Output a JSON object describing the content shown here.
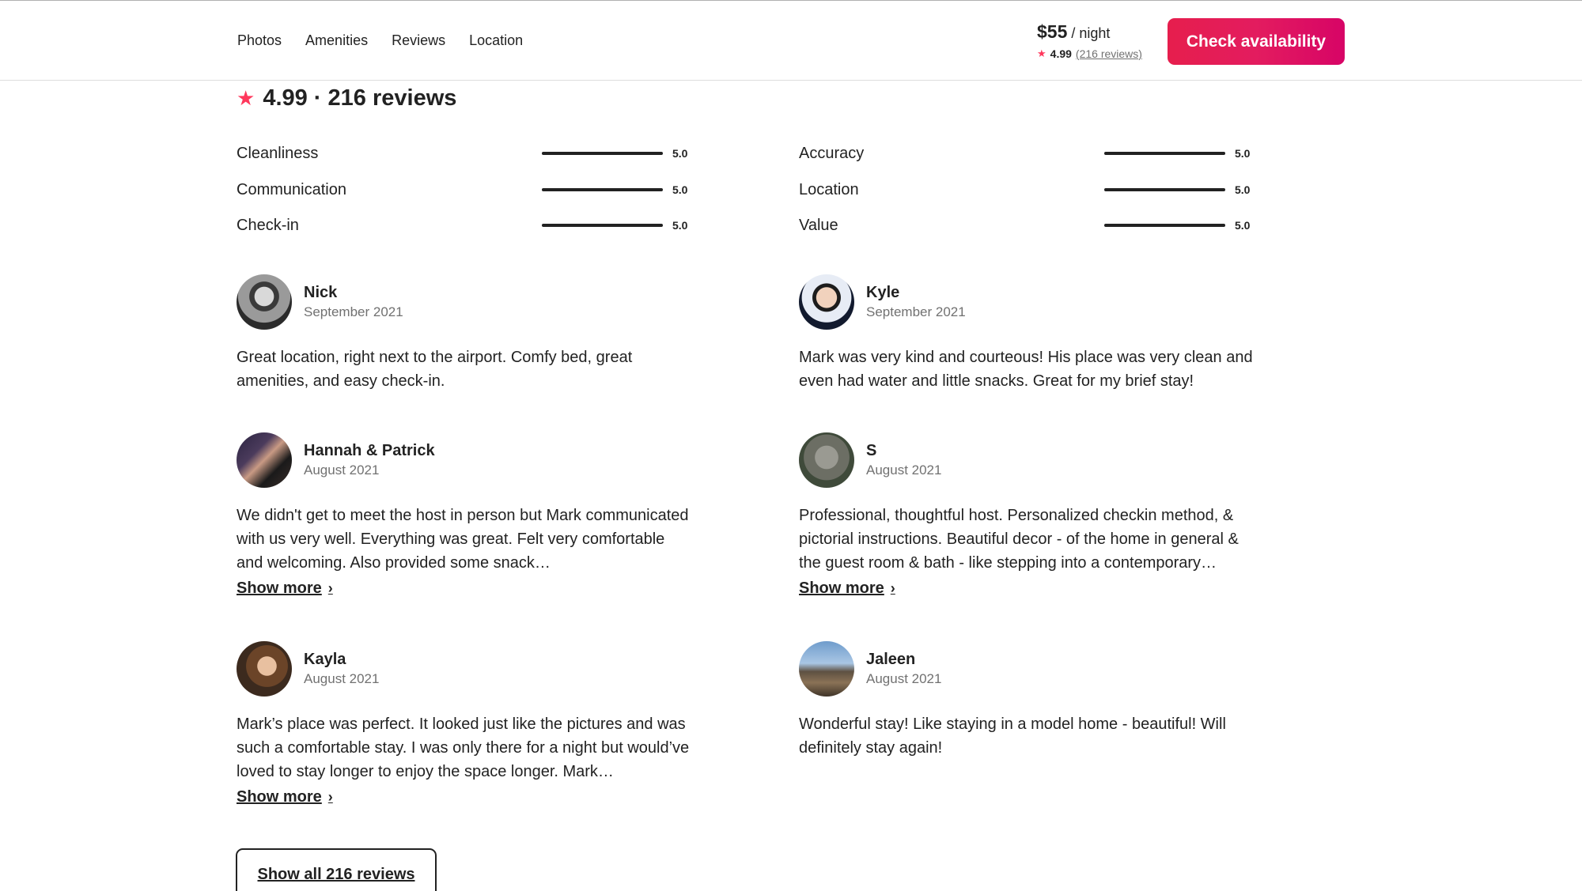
{
  "header": {
    "tabs": [
      "Photos",
      "Amenities",
      "Reviews",
      "Location"
    ],
    "price": "$55",
    "per_night": "/ night",
    "rating": "4.99",
    "reviews_link": "(216 reviews)",
    "cta_label": "Check availability",
    "accent_color": "#e31c5f"
  },
  "summary": {
    "icon": "star-icon",
    "text": "4.99 · 216 reviews"
  },
  "categories": [
    {
      "label": "Cleanliness",
      "value": "5.0",
      "fraction": 1.0
    },
    {
      "label": "Communication",
      "value": "5.0",
      "fraction": 1.0
    },
    {
      "label": "Check-in",
      "value": "5.0",
      "fraction": 1.0
    },
    {
      "label": "Accuracy",
      "value": "5.0",
      "fraction": 1.0
    },
    {
      "label": "Location",
      "value": "5.0",
      "fraction": 1.0
    },
    {
      "label": "Value",
      "value": "5.0",
      "fraction": 1.0
    }
  ],
  "reviews": [
    {
      "name": "Nick",
      "date": "September 2021",
      "text": "Great location, right next to the airport. Comfy bed, great amenities, and easy check-in.",
      "show_more": ""
    },
    {
      "name": "Kyle",
      "date": "September 2021",
      "text": "Mark was very kind and courteous! His place was very clean and even had water and little snacks. Great for my brief stay!",
      "show_more": ""
    },
    {
      "name": "Hannah & Patrick",
      "date": "August 2021",
      "text": "We didn't get to meet the host in person but Mark communicated with us very well. Everything was great. Felt very comfortable and welcoming. Also provided some snack…",
      "show_more": "Show more"
    },
    {
      "name": "S",
      "date": "August 2021",
      "text": "Professional, thoughtful host. Personalized checkin method, & pictorial instructions. Beautiful decor - of the home in general & the guest room & bath - like stepping into a contemporary…",
      "show_more": "Show more"
    },
    {
      "name": "Kayla",
      "date": "August 2021",
      "text": "Mark’s place was perfect. It looked just like the pictures and was such a comfortable stay. I was only there for a night but would’ve loved to stay longer to enjoy the space longer. Mark…",
      "show_more": "Show more"
    },
    {
      "name": "Jaleen",
      "date": "August 2021",
      "text": "Wonderful stay! Like staying in a model home - beautiful! Will definitely stay again!",
      "show_more": ""
    }
  ],
  "show_all_label": "Show all 216 reviews"
}
